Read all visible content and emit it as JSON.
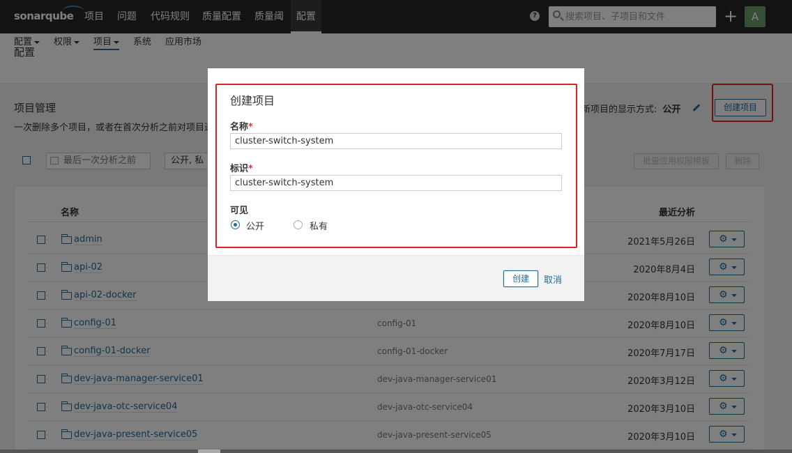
{
  "topnav": {
    "logo": "sonarqube",
    "items": [
      "项目",
      "问题",
      "代码规则",
      "质量配置",
      "质量阈",
      "配置"
    ],
    "help_label": "?",
    "search_placeholder": "搜索项目、子项目和文件",
    "plus_label": "+",
    "avatar_label": "A"
  },
  "page": {
    "title": "配置",
    "subnav": [
      "配置",
      "权限",
      "项目",
      "系统",
      "应用市场"
    ]
  },
  "section": {
    "title": "项目管理",
    "description": "一次删除多个项目，或者在首次分析之前对项目进",
    "default_visibility_label": "新项目的显示方式:",
    "default_visibility_value": "公开",
    "create_button": "创建项目"
  },
  "filters": {
    "date_placeholder": "最后一次分析之前",
    "visibility_value": "公开, 私有",
    "bulk_apply_template": "批量应用权限模板",
    "delete": "删除"
  },
  "table": {
    "headers": {
      "name": "名称",
      "last_analysis": "最近分析"
    },
    "rows": [
      {
        "name": "admin",
        "key": "",
        "date": "2021年5月26日"
      },
      {
        "name": "api-02",
        "key": "",
        "date": "2020年8月4日"
      },
      {
        "name": "api-02-docker",
        "key": "",
        "date": "2020年8月10日"
      },
      {
        "name": "config-01",
        "key": "config-01",
        "date": "2020年8月10日"
      },
      {
        "name": "config-01-docker",
        "key": "config-01-docker",
        "date": "2020年7月17日"
      },
      {
        "name": "dev-java-manager-service01",
        "key": "dev-java-manager-service01",
        "date": "2020年3月12日"
      },
      {
        "name": "dev-java-otc-service04",
        "key": "dev-java-otc-service04",
        "date": "2020年3月10日"
      },
      {
        "name": "dev-java-present-service05",
        "key": "dev-java-present-service05",
        "date": "2020年3月10日"
      }
    ]
  },
  "modal": {
    "title": "创建项目",
    "name_label": "名称",
    "name_value": "cluster-switch-system",
    "key_label": "标识",
    "key_value": "cluster-switch-system",
    "required_mark": "*",
    "visibility_label": "可见",
    "option_public": "公开",
    "option_private": "私有",
    "selected_visibility": "公开",
    "create_button": "创建",
    "cancel_link": "取消"
  },
  "colors": {
    "nav_bg": "#262626",
    "accent": "#236a97",
    "highlight": "#e02020"
  }
}
